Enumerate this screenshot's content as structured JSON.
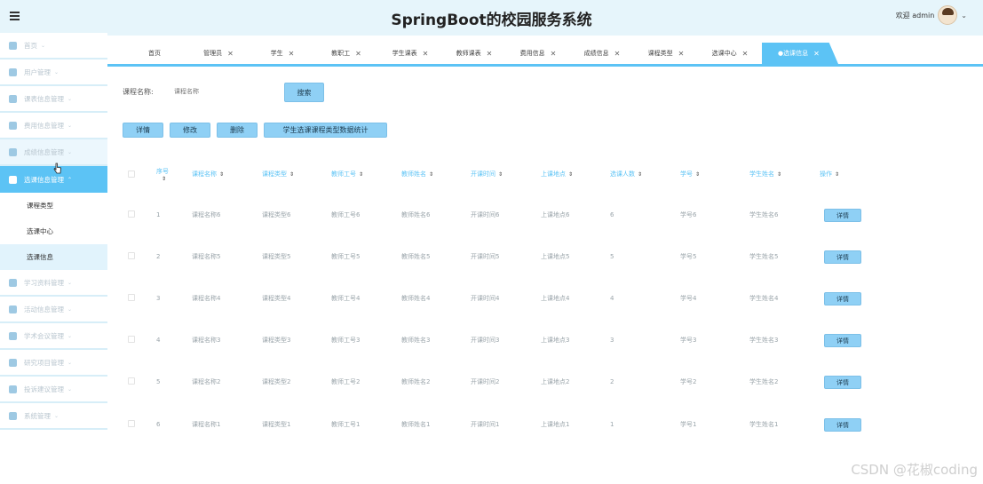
{
  "header": {
    "title": "SpringBoot的校园服务系统",
    "user_greeting": "欢迎 admin"
  },
  "sidebar": {
    "items": [
      {
        "label": "首页",
        "icon": "home-icon"
      },
      {
        "label": "用户管理",
        "icon": "user-icon"
      },
      {
        "label": "课表信息管理",
        "icon": "calendar-icon"
      },
      {
        "label": "费用信息管理",
        "icon": "receipt-icon"
      },
      {
        "label": "成绩信息管理",
        "icon": "grade-icon"
      },
      {
        "label": "选课信息管理",
        "icon": "copy-icon"
      },
      {
        "label": "学习资料管理",
        "icon": "pie-icon"
      },
      {
        "label": "活动信息管理",
        "icon": "panel-icon"
      },
      {
        "label": "学术会议管理",
        "icon": "meeting-icon"
      },
      {
        "label": "研究项目管理",
        "icon": "grid-icon"
      },
      {
        "label": "投诉建议管理",
        "icon": "complaint-icon"
      },
      {
        "label": "系统管理",
        "icon": "system-icon"
      }
    ],
    "sub_items": [
      "课程类型",
      "选课中心",
      "选课信息"
    ]
  },
  "tabs": [
    {
      "label": "首页",
      "closable": false
    },
    {
      "label": "管理员",
      "closable": true
    },
    {
      "label": "学生",
      "closable": true
    },
    {
      "label": "教职工",
      "closable": true
    },
    {
      "label": "学生课表",
      "closable": true
    },
    {
      "label": "教师课表",
      "closable": true
    },
    {
      "label": "费用信息",
      "closable": true
    },
    {
      "label": "成绩信息",
      "closable": true
    },
    {
      "label": "课程类型",
      "closable": true
    },
    {
      "label": "选课中心",
      "closable": true
    },
    {
      "label": "●选课信息",
      "closable": true
    }
  ],
  "search": {
    "label": "课程名称:",
    "placeholder": "课程名称",
    "button": "搜索"
  },
  "actions": {
    "detail": "详情",
    "edit": "修改",
    "delete": "删除",
    "stats": "学生选课课程类型数据统计"
  },
  "table": {
    "columns": [
      "序号",
      "课程名称",
      "课程类型",
      "教师工号",
      "教师姓名",
      "开课时间",
      "上课地点",
      "选课人数",
      "学号",
      "学生姓名",
      "操作"
    ],
    "row_button": "详情",
    "rows": [
      [
        "1",
        "课程名称6",
        "课程类型6",
        "教师工号6",
        "教师姓名6",
        "开课时间6",
        "上课地点6",
        "6",
        "学号6",
        "学生姓名6"
      ],
      [
        "2",
        "课程名称5",
        "课程类型5",
        "教师工号5",
        "教师姓名5",
        "开课时间5",
        "上课地点5",
        "5",
        "学号5",
        "学生姓名5"
      ],
      [
        "3",
        "课程名称4",
        "课程类型4",
        "教师工号4",
        "教师姓名4",
        "开课时间4",
        "上课地点4",
        "4",
        "学号4",
        "学生姓名4"
      ],
      [
        "4",
        "课程名称3",
        "课程类型3",
        "教师工号3",
        "教师姓名3",
        "开课时间3",
        "上课地点3",
        "3",
        "学号3",
        "学生姓名3"
      ],
      [
        "5",
        "课程名称2",
        "课程类型2",
        "教师工号2",
        "教师姓名2",
        "开课时间2",
        "上课地点2",
        "2",
        "学号2",
        "学生姓名2"
      ],
      [
        "6",
        "课程名称1",
        "课程类型1",
        "教师工号1",
        "教师姓名1",
        "开课时间1",
        "上课地点1",
        "1",
        "学号1",
        "学生姓名1"
      ]
    ]
  },
  "watermark": "CSDN @花椒coding"
}
